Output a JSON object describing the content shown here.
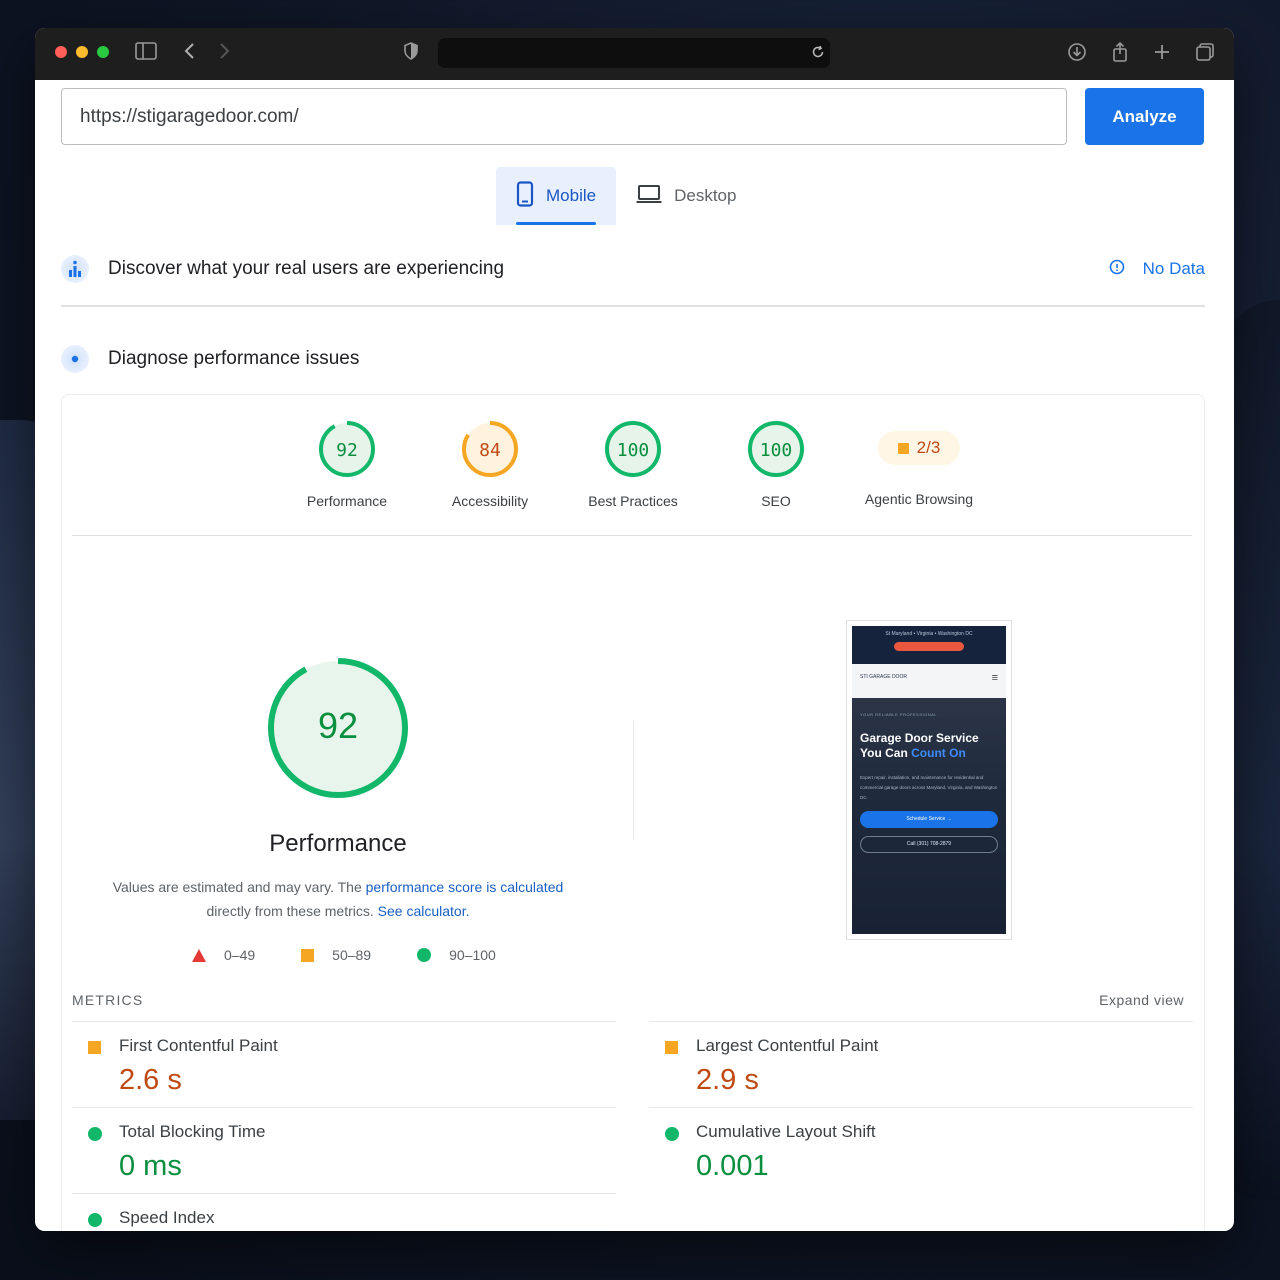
{
  "browser": {
    "traffic_colors": [
      "#ff5f57",
      "#febc2e",
      "#28c840"
    ]
  },
  "search": {
    "url_value": "https://stigaragedoor.com/",
    "analyze_label": "Analyze"
  },
  "tabs": [
    {
      "label": "Mobile",
      "active": true
    },
    {
      "label": "Desktop",
      "active": false
    }
  ],
  "crux": {
    "title": "Discover what your real users are experiencing",
    "status": "No Data"
  },
  "diagnose": {
    "title": "Diagnose performance issues"
  },
  "scores": [
    {
      "label": "Performance",
      "value": "92",
      "fraction": 0.92,
      "color": "#12b76a",
      "track": "#e6f4ea",
      "text": "#0a8f3e"
    },
    {
      "label": "Accessibility",
      "value": "84",
      "fraction": 0.84,
      "color": "#f5a623",
      "track": "#fff3e0",
      "text": "#c04a14"
    },
    {
      "label": "Best Practices",
      "value": "100",
      "fraction": 1.0,
      "color": "#12b76a",
      "track": "#e6f4ea",
      "text": "#0a8f3e"
    },
    {
      "label": "SEO",
      "value": "100",
      "fraction": 1.0,
      "color": "#12b76a",
      "track": "#e6f4ea",
      "text": "#0a8f3e"
    }
  ],
  "agentic": {
    "label": "Agentic Browsing",
    "value": "2/3"
  },
  "performance": {
    "score": "92",
    "fraction": 0.92,
    "title": "Performance",
    "desc_1": "Values are estimated and may vary. The ",
    "desc_link_1": "performance score is calculated",
    "desc_2": " directly from these metrics. ",
    "desc_link_2": "See calculator."
  },
  "legend": {
    "fail": "0–49",
    "average": "50–89",
    "pass": "90–100"
  },
  "preview": {
    "top_text": "St Maryland • Virginia • Washington DC",
    "logo_text": "STI GARAGE DOOR",
    "kicker": "YOUR RELIABLE PROFESSIONAL",
    "headline_1": "Garage Door Service",
    "headline_2": "You Can ",
    "headline_accent": "Count On",
    "body": "Expert repair, installation, and maintenance for residential and commercial garage doors across Maryland, Virginia, and Washington DC.",
    "btn_primary": "Schedule Service →",
    "btn_secondary": "Call (301) 708-2879"
  },
  "metrics": {
    "header": "METRICS",
    "expand": "Expand view",
    "items": [
      {
        "name": "First Contentful Paint",
        "value": "2.6 s",
        "status": "average"
      },
      {
        "name": "Largest Contentful Paint",
        "value": "2.9 s",
        "status": "average"
      },
      {
        "name": "Total Blocking Time",
        "value": "0 ms",
        "status": "pass"
      },
      {
        "name": "Cumulative Layout Shift",
        "value": "0.001",
        "status": "pass"
      },
      {
        "name": "Speed Index",
        "value": "",
        "status": "pass"
      }
    ]
  }
}
